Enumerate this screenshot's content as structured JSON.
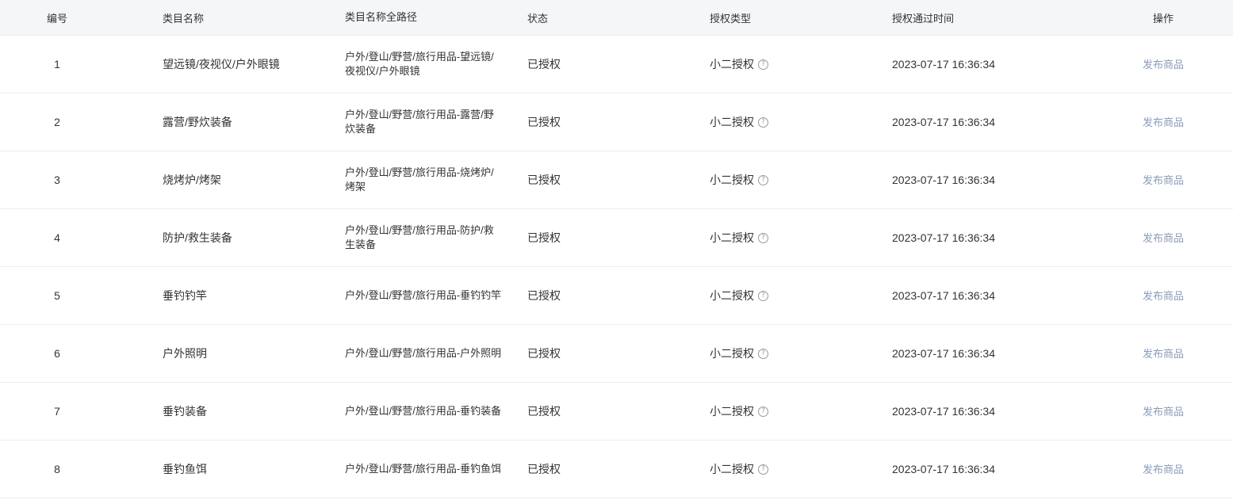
{
  "table": {
    "headers": {
      "id": "编号",
      "name": "类目名称",
      "path": "类目名称全路径",
      "status": "状态",
      "auth_type": "授权类型",
      "auth_time": "授权通过时间",
      "action": "操作"
    },
    "rows": [
      {
        "id": "1",
        "name": "望远镜/夜视仪/户外眼镜",
        "path": "户外/登山/野营/旅行用品-望远镜/夜视仪/户外眼镜",
        "status": "已授权",
        "auth_type": "小二授权",
        "auth_time": "2023-07-17 16:36:34",
        "action": "发布商品"
      },
      {
        "id": "2",
        "name": "露营/野炊装备",
        "path": "户外/登山/野营/旅行用品-露营/野炊装备",
        "status": "已授权",
        "auth_type": "小二授权",
        "auth_time": "2023-07-17 16:36:34",
        "action": "发布商品"
      },
      {
        "id": "3",
        "name": "烧烤炉/烤架",
        "path": "户外/登山/野营/旅行用品-烧烤炉/烤架",
        "status": "已授权",
        "auth_type": "小二授权",
        "auth_time": "2023-07-17 16:36:34",
        "action": "发布商品"
      },
      {
        "id": "4",
        "name": "防护/救生装备",
        "path": "户外/登山/野营/旅行用品-防护/救生装备",
        "status": "已授权",
        "auth_type": "小二授权",
        "auth_time": "2023-07-17 16:36:34",
        "action": "发布商品"
      },
      {
        "id": "5",
        "name": "垂钓钓竿",
        "path": "户外/登山/野营/旅行用品-垂钓钓竿",
        "status": "已授权",
        "auth_type": "小二授权",
        "auth_time": "2023-07-17 16:36:34",
        "action": "发布商品"
      },
      {
        "id": "6",
        "name": "户外照明",
        "path": "户外/登山/野营/旅行用品-户外照明",
        "status": "已授权",
        "auth_type": "小二授权",
        "auth_time": "2023-07-17 16:36:34",
        "action": "发布商品"
      },
      {
        "id": "7",
        "name": "垂钓装备",
        "path": "户外/登山/野营/旅行用品-垂钓装备",
        "status": "已授权",
        "auth_type": "小二授权",
        "auth_time": "2023-07-17 16:36:34",
        "action": "发布商品"
      },
      {
        "id": "8",
        "name": "垂钓鱼饵",
        "path": "户外/登山/野营/旅行用品-垂钓鱼饵",
        "status": "已授权",
        "auth_type": "小二授权",
        "auth_time": "2023-07-17 16:36:34",
        "action": "发布商品"
      }
    ]
  },
  "icons": {
    "help": "question-circle-icon",
    "help_glyph": "?"
  },
  "colors": {
    "header_bg": "#f5f6f8",
    "border": "#eeeeee",
    "text": "#333333",
    "action_link": "#8a9bb8",
    "help_icon": "#999999"
  }
}
